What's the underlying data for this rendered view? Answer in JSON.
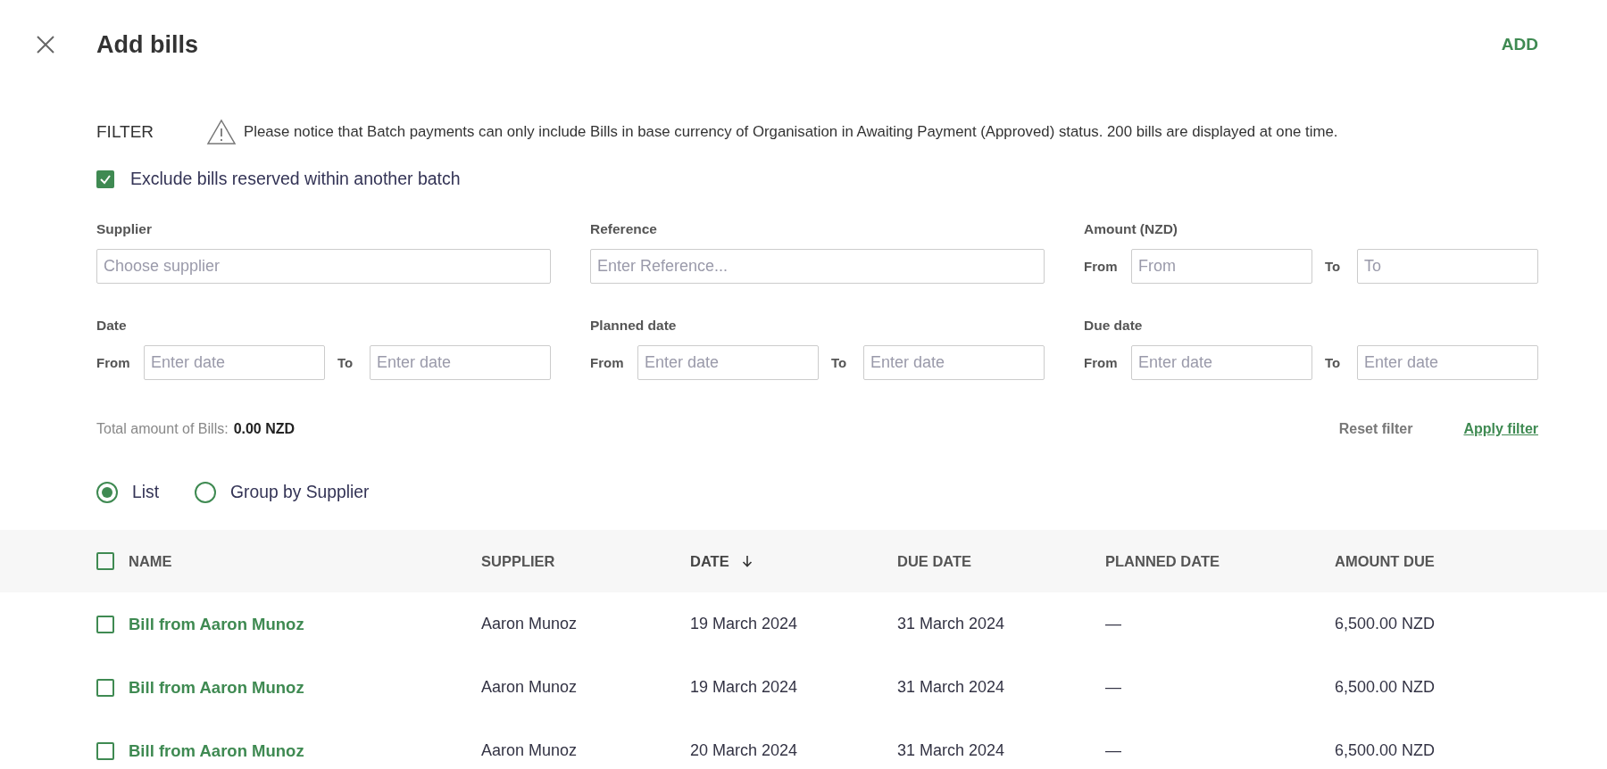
{
  "header": {
    "title": "Add bills",
    "action": "ADD"
  },
  "filter": {
    "label": "FILTER",
    "notice": "Please notice that Batch payments can only include Bills in base currency of Organisation in Awaiting Payment (Approved) status. 200 bills are displayed at one time.",
    "exclude": {
      "label": "Exclude bills reserved within another batch",
      "checked": true
    },
    "fields": [
      {
        "kind": "single",
        "label": "Supplier",
        "placeholder": "Choose supplier"
      },
      {
        "kind": "single",
        "label": "Reference",
        "placeholder": "Enter Reference..."
      },
      {
        "kind": "range",
        "label": "Amount (NZD)",
        "from_label": "From",
        "from_placeholder": "From",
        "to_label": "To",
        "to_placeholder": "To"
      },
      {
        "kind": "range",
        "label": "Date",
        "from_label": "From",
        "from_placeholder": "Enter date",
        "to_label": "To",
        "to_placeholder": "Enter date"
      },
      {
        "kind": "range",
        "label": "Planned date",
        "from_label": "From",
        "from_placeholder": "Enter date",
        "to_label": "To",
        "to_placeholder": "Enter date"
      },
      {
        "kind": "range",
        "label": "Due date",
        "from_label": "From",
        "from_placeholder": "Enter date",
        "to_label": "To",
        "to_placeholder": "Enter date"
      }
    ],
    "total_label": "Total amount of Bills:",
    "total_value": "0.00 NZD",
    "reset": "Reset filter",
    "apply": "Apply filter"
  },
  "view_options": [
    {
      "label": "List",
      "selected": true
    },
    {
      "label": "Group by Supplier",
      "selected": false
    }
  ],
  "table": {
    "select_all_checked": false,
    "columns": [
      {
        "label": "NAME",
        "sorted": false
      },
      {
        "label": "SUPPLIER",
        "sorted": false
      },
      {
        "label": "DATE",
        "sorted": true
      },
      {
        "label": "DUE DATE",
        "sorted": false
      },
      {
        "label": "PLANNED DATE",
        "sorted": false
      },
      {
        "label": "AMOUNT DUE",
        "sorted": false
      }
    ],
    "rows": [
      {
        "checked": false,
        "name": "Bill from Aaron Munoz",
        "supplier": "Aaron Munoz",
        "date": "19 March 2024",
        "due_date": "31 March 2024",
        "planned_date": "—",
        "amount_due": "6,500.00 NZD"
      },
      {
        "checked": false,
        "name": "Bill from Aaron Munoz",
        "supplier": "Aaron Munoz",
        "date": "19 March 2024",
        "due_date": "31 March 2024",
        "planned_date": "—",
        "amount_due": "6,500.00 NZD"
      },
      {
        "checked": false,
        "name": "Bill from Aaron Munoz",
        "supplier": "Aaron Munoz",
        "date": "20 March 2024",
        "due_date": "31 March 2024",
        "planned_date": "—",
        "amount_due": "6,500.00 NZD"
      }
    ]
  }
}
